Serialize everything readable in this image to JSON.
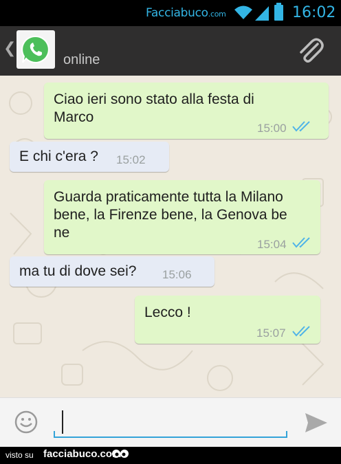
{
  "status_bar": {
    "watermark_main": "Facciabuco",
    "watermark_suffix": ".com",
    "time": "16:02",
    "icons": [
      "wifi-icon",
      "signal-icon",
      "battery-icon"
    ]
  },
  "header": {
    "back_glyph": "❮",
    "avatar_icon": "whatsapp-logo",
    "contact_status": "online",
    "attach_icon": "paperclip-icon"
  },
  "messages": [
    {
      "direction": "out",
      "text_lines": [
        "Ciao ieri sono stato alla festa di",
        "Marco"
      ],
      "time": "15:00",
      "read": true
    },
    {
      "direction": "in",
      "text_lines": [
        "E chi c'era ?"
      ],
      "time": "15:02"
    },
    {
      "direction": "out",
      "text_lines": [
        "Guarda praticamente tutta la Milano",
        "bene, la Firenze bene, la Genova be",
        "ne"
      ],
      "time": "15:04",
      "read": true
    },
    {
      "direction": "in",
      "text_lines": [
        "ma tu di dove sei?"
      ],
      "time": "15:06"
    },
    {
      "direction": "out",
      "text_lines": [
        "Lecco !"
      ],
      "time": "15:07",
      "read": true
    }
  ],
  "composer": {
    "value": "",
    "emoji_icon": "smiley-icon",
    "send_icon": "send-icon"
  },
  "footer": {
    "visto_label": "visto su",
    "brand": "facciabuco.com"
  },
  "colors": {
    "accent": "#33b5e5",
    "outgoing_bubble": "#e1f7c9",
    "incoming_bubble": "#e6ebf5",
    "chat_bg": "#efe9df",
    "read_ticks": "#4fb3e8"
  }
}
